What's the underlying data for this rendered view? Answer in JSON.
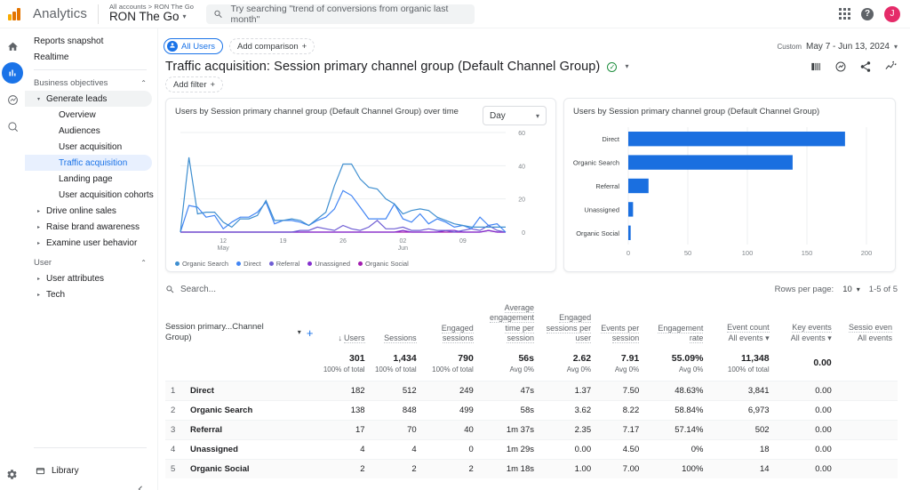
{
  "header": {
    "brand": "Analytics",
    "account_breadcrumb": "All accounts > RON The Go",
    "property_name": "RON The Go",
    "property_caret": "▾",
    "search_placeholder": "Try searching \"trend of conversions from organic last month\"",
    "search_icon": "search-icon",
    "apps_icon": "apps-grid-icon",
    "help_icon": "help-icon",
    "help_glyph": "?",
    "avatar_initial": "J",
    "avatar_color": "#e52b69"
  },
  "rail": {
    "items": [
      {
        "name": "home-icon",
        "glyph": "home"
      },
      {
        "name": "reports-icon",
        "glyph": "reports",
        "active": true
      },
      {
        "name": "explore-icon",
        "glyph": "explore"
      },
      {
        "name": "advertising-icon",
        "glyph": "advertising"
      }
    ],
    "settings_icon": "gear-icon"
  },
  "sidebar": {
    "items": [
      {
        "label": "Reports snapshot",
        "level": 0,
        "state": "plain"
      },
      {
        "label": "Realtime",
        "level": 0,
        "state": "plain"
      },
      {
        "label": "Business objectives",
        "level": 0,
        "state": "section",
        "chevron": "⌃"
      },
      {
        "label": "Generate leads",
        "level": 0,
        "state": "highlight",
        "tri": "▾"
      },
      {
        "label": "Overview",
        "level": 1,
        "state": "plain"
      },
      {
        "label": "Audiences",
        "level": 1,
        "state": "plain"
      },
      {
        "label": "User acquisition",
        "level": 1,
        "state": "plain"
      },
      {
        "label": "Traffic acquisition",
        "level": 1,
        "state": "selected"
      },
      {
        "label": "Landing page",
        "level": 1,
        "state": "plain"
      },
      {
        "label": "User acquisition cohorts",
        "level": 1,
        "state": "plain"
      },
      {
        "label": "Drive online sales",
        "level": 0,
        "state": "collapsed",
        "tri": "▸"
      },
      {
        "label": "Raise brand awareness",
        "level": 0,
        "state": "collapsed",
        "tri": "▸"
      },
      {
        "label": "Examine user behavior",
        "level": 0,
        "state": "collapsed",
        "tri": "▸"
      },
      {
        "label": "User",
        "level": 0,
        "state": "section",
        "chevron": "⌃"
      },
      {
        "label": "User attributes",
        "level": 0,
        "state": "collapsed",
        "tri": "▸"
      },
      {
        "label": "Tech",
        "level": 0,
        "state": "collapsed",
        "tri": "▸"
      }
    ],
    "library_label": "Library",
    "library_icon": "folder-icon",
    "collapse_icon": "chevron-left-icon"
  },
  "report": {
    "audience_chip": "All Users",
    "audience_chip_icon": "person-icon",
    "add_comparison": "Add comparison",
    "add_comparison_plus": "+",
    "date_label": "Custom",
    "date_range": "May 7 - Jun 13, 2024",
    "date_caret": "▾",
    "title": "Traffic acquisition: Session primary channel group (Default Channel Group)",
    "title_badge": "✓",
    "title_caret": "▾",
    "add_filter": "Add filter",
    "add_filter_plus": "+",
    "actions": [
      {
        "name": "compare-icon",
        "label": "compare"
      },
      {
        "name": "insights-icon",
        "label": "insights"
      },
      {
        "name": "share-icon",
        "label": "share"
      },
      {
        "name": "customize-icon",
        "label": "customize"
      }
    ]
  },
  "chart_data": [
    {
      "type": "line",
      "card": "timeseries",
      "title": "Users by Session primary channel group (Default Channel Group) over time",
      "granularity_label": "Day",
      "granularity_caret": "▾",
      "xlabel": "",
      "ylabel": "",
      "ylim": [
        0,
        60
      ],
      "yticks": [
        0,
        20,
        40,
        60
      ],
      "xticks": [
        "12",
        "19",
        "26",
        "02",
        "09"
      ],
      "xtick_sublabels": [
        "May",
        "",
        "",
        "Jun",
        ""
      ],
      "grid": true,
      "legend_position": "bottom-left",
      "series": [
        {
          "name": "Organic Search",
          "color": "#3f8fd0",
          "values": [
            0,
            45,
            11,
            12,
            12,
            6,
            3,
            8,
            8,
            10,
            19,
            7,
            7,
            8,
            7,
            4,
            8,
            12,
            28,
            41,
            41,
            32,
            27,
            26,
            20,
            17,
            11,
            13,
            14,
            13,
            9,
            7,
            5,
            4,
            3,
            3,
            3,
            3,
            3
          ]
        },
        {
          "name": "Direct",
          "color": "#4285f4",
          "values": [
            0,
            16,
            15,
            9,
            10,
            2,
            6,
            9,
            9,
            12,
            18,
            5,
            7,
            7,
            6,
            4,
            7,
            9,
            14,
            25,
            22,
            15,
            8,
            8,
            8,
            17,
            8,
            6,
            11,
            5,
            8,
            6,
            3,
            4,
            2,
            9,
            4,
            5,
            0
          ]
        },
        {
          "name": "Referral",
          "color": "#6f5ed4",
          "values": [
            0,
            0,
            0,
            0,
            0,
            0,
            0,
            0,
            0,
            0,
            0,
            0,
            0,
            0,
            1,
            1,
            3,
            2,
            1,
            4,
            2,
            1,
            3,
            7,
            2,
            2,
            3,
            1,
            1,
            2,
            1,
            1,
            0,
            1,
            2,
            1,
            4,
            1,
            0
          ]
        },
        {
          "name": "Unassigned",
          "color": "#8430ce",
          "values": [
            0,
            0,
            0,
            0,
            0,
            0,
            0,
            0,
            0,
            0,
            0,
            0,
            0,
            0,
            0,
            0,
            0,
            0,
            0,
            0,
            0,
            0,
            0,
            0,
            0,
            0,
            1,
            0,
            0,
            0,
            0,
            1,
            1,
            0,
            0,
            0,
            1,
            0,
            0
          ]
        },
        {
          "name": "Organic Social",
          "color": "#a21caf",
          "values": [
            0,
            0,
            0,
            0,
            0,
            0,
            0,
            0,
            0,
            0,
            0,
            0,
            0,
            0,
            0,
            0,
            0,
            0,
            0,
            0,
            0,
            0,
            0,
            0,
            0,
            0,
            0,
            0,
            0,
            0,
            0,
            0,
            0,
            0,
            0,
            0,
            1,
            0,
            0
          ]
        }
      ]
    },
    {
      "type": "bar",
      "card": "bar",
      "title": "Users by Session primary channel group (Default Channel Group)",
      "orientation": "horizontal",
      "categories": [
        "Direct",
        "Organic Search",
        "Referral",
        "Unassigned",
        "Organic Social"
      ],
      "values": [
        182,
        138,
        17,
        4,
        2
      ],
      "bar_color": "#1a6fe0",
      "xlim": [
        0,
        200
      ],
      "xticks": [
        0,
        50,
        100,
        150,
        200
      ],
      "grid": true
    }
  ],
  "table": {
    "search_placeholder": "Search...",
    "search_icon": "search-icon",
    "rows_per_page_label": "Rows per page:",
    "rows_per_page_value": "10",
    "rows_per_page_caret": "▾",
    "pagination": "1-5 of 5",
    "dimension_label": "Session primary...Channel Group)",
    "dimension_caret": "▾",
    "add_dimension_plus": "+",
    "sort_arrow": "↓",
    "columns": [
      {
        "key": "users",
        "label": "Users",
        "sorted": true
      },
      {
        "key": "sessions",
        "label": "Sessions"
      },
      {
        "key": "engaged_sessions",
        "label": "Engaged sessions"
      },
      {
        "key": "avg_engagement_time",
        "label": "Average engagement time per session"
      },
      {
        "key": "engaged_per_user",
        "label": "Engaged sessions per user"
      },
      {
        "key": "events_per_session",
        "label": "Events per session"
      },
      {
        "key": "engagement_rate",
        "label": "Engagement rate"
      },
      {
        "key": "event_count",
        "label": "Event count",
        "sublabel": "All events",
        "caret": "▾"
      },
      {
        "key": "key_events",
        "label": "Key events",
        "sublabel": "All events",
        "caret": "▾"
      },
      {
        "key": "session_key_events",
        "label": "Sessio even",
        "sublabel": "All events"
      }
    ],
    "totals": [
      {
        "value": "301",
        "sub": "100% of total"
      },
      {
        "value": "1,434",
        "sub": "100% of total"
      },
      {
        "value": "790",
        "sub": "100% of total"
      },
      {
        "value": "56s",
        "sub": "Avg 0%"
      },
      {
        "value": "2.62",
        "sub": "Avg 0%"
      },
      {
        "value": "7.91",
        "sub": "Avg 0%"
      },
      {
        "value": "55.09%",
        "sub": "Avg 0%"
      },
      {
        "value": "11,348",
        "sub": "100% of total"
      },
      {
        "value": "0.00",
        "sub": ""
      },
      {
        "value": "",
        "sub": ""
      }
    ],
    "rows": [
      {
        "index": "1",
        "name": "Direct",
        "cells": [
          "182",
          "512",
          "249",
          "47s",
          "1.37",
          "7.50",
          "48.63%",
          "3,841",
          "0.00",
          ""
        ]
      },
      {
        "index": "2",
        "name": "Organic Search",
        "cells": [
          "138",
          "848",
          "499",
          "58s",
          "3.62",
          "8.22",
          "58.84%",
          "6,973",
          "0.00",
          ""
        ]
      },
      {
        "index": "3",
        "name": "Referral",
        "cells": [
          "17",
          "70",
          "40",
          "1m 37s",
          "2.35",
          "7.17",
          "57.14%",
          "502",
          "0.00",
          ""
        ]
      },
      {
        "index": "4",
        "name": "Unassigned",
        "cells": [
          "4",
          "4",
          "0",
          "1m 29s",
          "0.00",
          "4.50",
          "0%",
          "18",
          "0.00",
          ""
        ]
      },
      {
        "index": "5",
        "name": "Organic Social",
        "cells": [
          "2",
          "2",
          "2",
          "1m 18s",
          "1.00",
          "7.00",
          "100%",
          "14",
          "0.00",
          ""
        ]
      }
    ]
  }
}
